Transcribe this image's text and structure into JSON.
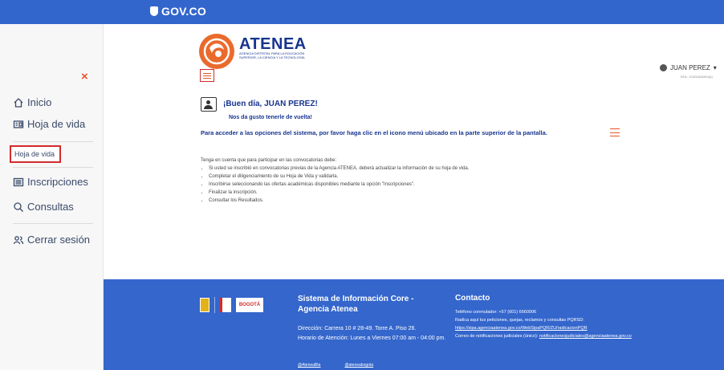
{
  "govbar": {
    "brand": "GOV.CO"
  },
  "sidebar": {
    "close_label": "×",
    "items": [
      {
        "label": "Inicio",
        "icon": "home-icon"
      },
      {
        "label": "Hoja de vida",
        "icon": "id-card-icon"
      },
      {
        "label": "Hoja de vida"
      },
      {
        "label": "Inscripciones",
        "icon": "list-icon"
      },
      {
        "label": "Consultas",
        "icon": "search-icon"
      },
      {
        "label": "Cerrar sesión",
        "icon": "users-icon"
      }
    ]
  },
  "header": {
    "brand_title": "ATENEA",
    "brand_sub": "AGENCIA DISTRITAL PARA LA EDUCACIÓN SUPERIOR, LA CIENCIA Y LA TECNOLOGÍA",
    "user_name": "JUAN PEREZ",
    "user_caret": "▾",
    "user_role": "ROL: CIUDADANO(A)"
  },
  "main": {
    "greeting": "¡Buen día, JUAN PEREZ!",
    "glad": "Nos da gusto tenerle de vuelta!",
    "instruction": "Para acceder a las opciones del sistema, por favor haga clic en el icono menú ubicado en la parte superior de la pantalla.",
    "notes_intro": "Tenga en cuenta que para participar en las convocatorias debe:",
    "notes": [
      "Si usted se inscribió en convocatorias previas de la Agencia ATENEA, deberá actualizar la información de su hoja de vida.",
      "Completar el diligenciamiento de su Hoja de Vida y validarla.",
      "Inscribirse seleccionando las ofertas académicas disponibles mediante la opción \"Inscripciones\".",
      "Finalizar la inscripción.",
      "Consultar los Resultados."
    ]
  },
  "footer": {
    "logo_bogota": "BOGOTÁ",
    "title": "Sistema de Información Core - Agencia Atenea",
    "address": "Dirección: Carrera 10 # 28-49. Torre A. Piso 26.",
    "hours": "Horario de Atención: Lunes a Viernes 07:00 am - 04:00 pm.",
    "social_twitter": "@AteneaBta",
    "social_instagram": "@ateneabogota",
    "contact_title": "Contacto",
    "phone": "Teléfono conmutador: +57 (601) 6660006",
    "pqrsd_label": "Radica aquí tus peticiones, quejas, reclamos y consultas PQRSD:",
    "pqrsd_link": "https://sipa.agenciaatenea.gov.co/WebSipaPQR/ZU/radicacionPQR",
    "judicial_label": "Correo de notificaciones judiciales (único):",
    "judicial_link": "notificacionesjudiciales@agenciaatenea.gov.co"
  },
  "colors": {
    "gov_blue": "#3366cc",
    "brand_navy": "#17358f",
    "accent_orange": "#e8542a",
    "highlight_red": "#d22b2b"
  }
}
